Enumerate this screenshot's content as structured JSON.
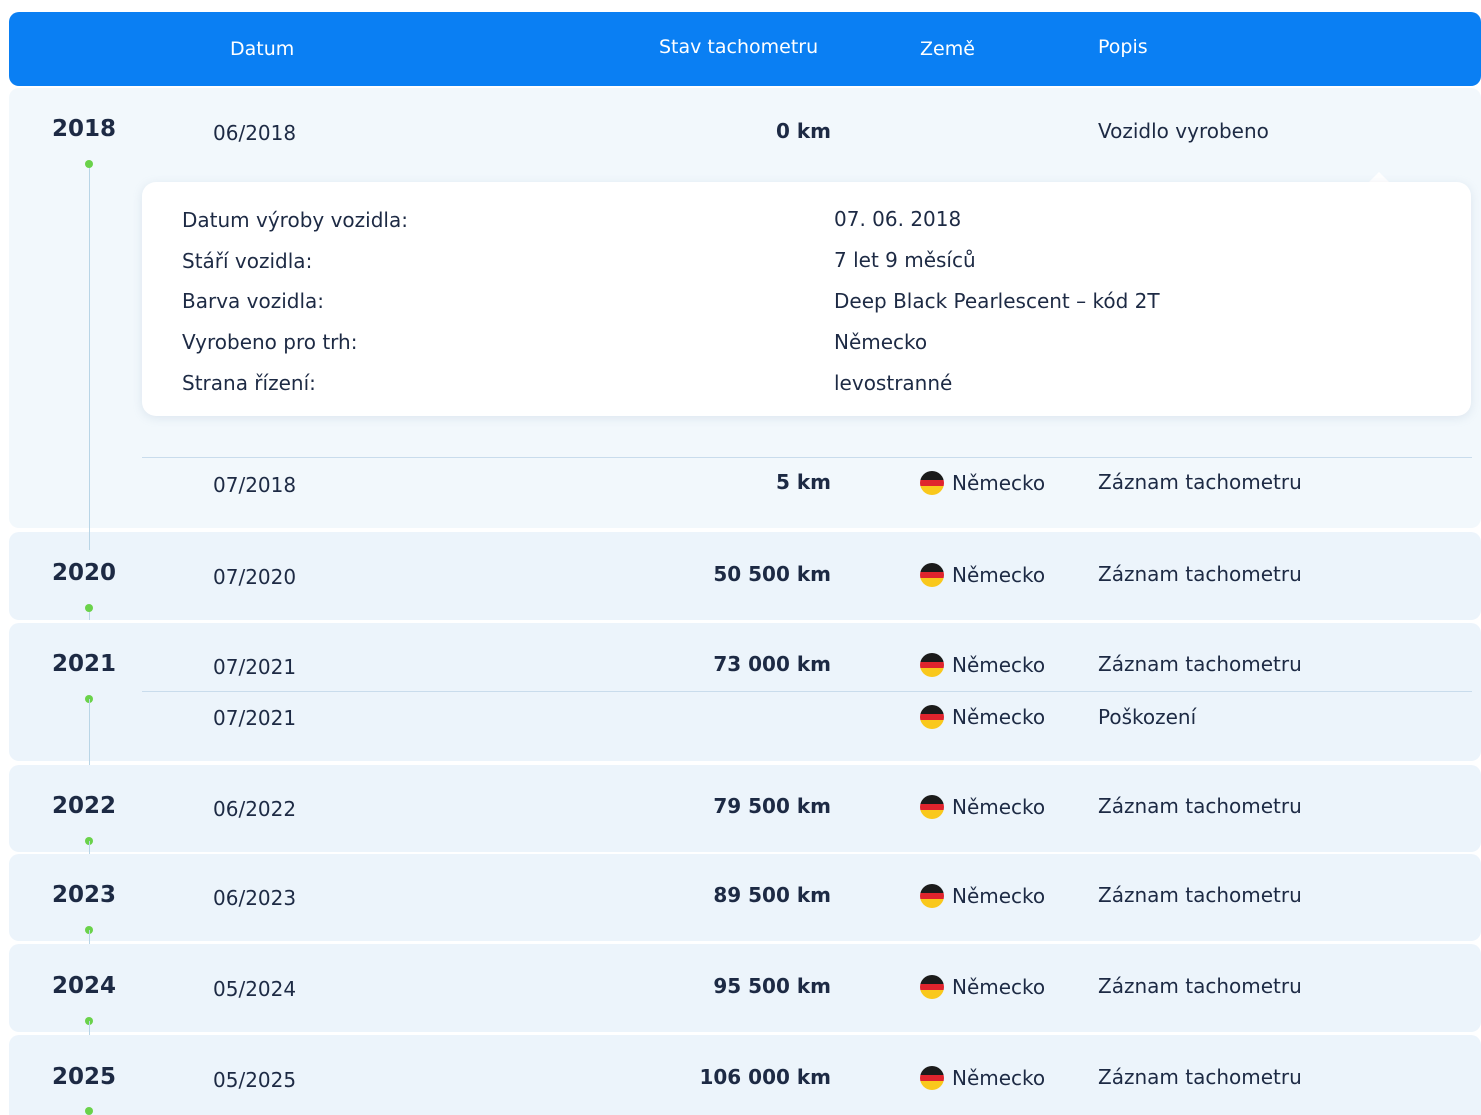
{
  "header": {
    "col_date": "Datum",
    "col_km": "Stav tachometru",
    "col_country": "Země",
    "col_desc": "Popis"
  },
  "details": {
    "rows": [
      {
        "label": "Datum výroby vozidla:",
        "value": "07. 06. 2018"
      },
      {
        "label": "Stáří vozidla:",
        "value": "7 let 9 měsíců"
      },
      {
        "label": "Barva vozidla:",
        "value": "Deep Black Pearlescent – kód 2T"
      },
      {
        "label": "Vyrobeno pro trh:",
        "value": "Německo"
      },
      {
        "label": "Strana řízení:",
        "value": "levostranné"
      }
    ]
  },
  "years": [
    {
      "year": "2018",
      "records": [
        {
          "date": "06/2018",
          "km": "0 km",
          "country": "",
          "desc": "Vozidlo vyrobeno"
        },
        {
          "date": "07/2018",
          "km": "5 km",
          "country": "Německo",
          "desc": "Záznam tachometru"
        }
      ]
    },
    {
      "year": "2020",
      "records": [
        {
          "date": "07/2020",
          "km": "50 500 km",
          "country": "Německo",
          "desc": "Záznam tachometru"
        }
      ]
    },
    {
      "year": "2021",
      "records": [
        {
          "date": "07/2021",
          "km": "73 000 km",
          "country": "Německo",
          "desc": "Záznam tachometru"
        },
        {
          "date": "07/2021",
          "km": "",
          "country": "Německo",
          "desc": "Poškození"
        }
      ]
    },
    {
      "year": "2022",
      "records": [
        {
          "date": "06/2022",
          "km": "79 500 km",
          "country": "Německo",
          "desc": "Záznam tachometru"
        }
      ]
    },
    {
      "year": "2023",
      "records": [
        {
          "date": "06/2023",
          "km": "89 500 km",
          "country": "Německo",
          "desc": "Záznam tachometru"
        }
      ]
    },
    {
      "year": "2024",
      "records": [
        {
          "date": "05/2024",
          "km": "95 500 km",
          "country": "Německo",
          "desc": "Záznam tachometru"
        }
      ]
    },
    {
      "year": "2025",
      "records": [
        {
          "date": "05/2025",
          "km": "106 000 km",
          "country": "Německo",
          "desc": "Záznam tachometru"
        }
      ]
    }
  ],
  "colors": {
    "header": "#0a7ff3",
    "timeline_dot": "#6ad24a",
    "row_bg": "#f2f8fc"
  }
}
